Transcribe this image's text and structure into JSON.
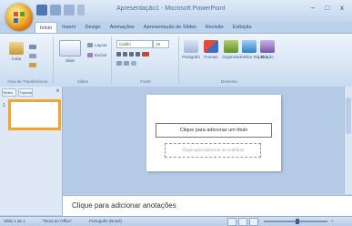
{
  "window": {
    "title": "Apresentação1 - Microsoft PowerPoint",
    "minimize": "–",
    "maximize": "□",
    "close": "x"
  },
  "tabs": [
    "Início",
    "Inserir",
    "Design",
    "Animações",
    "Apresentação de Slides",
    "Revisão",
    "Exibição"
  ],
  "ribbon": {
    "paste_label": "Colar",
    "new_slide_label": "Slide",
    "delete_label": "Excluir",
    "font_name": "Calibri",
    "font_size": "18",
    "drawing_label": "Desenho",
    "edit_label": "Edição",
    "layout_label": "Layout",
    "shapes_label": "Formas",
    "arrange_label": "Organizar",
    "quick_styles_label": "Estilos Rápidos",
    "groups": {
      "clipboard": "Área de Transferência",
      "slides": "Slides",
      "font": "Fonte",
      "paragraph": "Parágrafo",
      "drawing": "Desenho"
    }
  },
  "slide_pane": {
    "tab_slides": "Slides",
    "tab_outline": "Tópicos",
    "close": "x",
    "slide_number": "1"
  },
  "slide": {
    "title_placeholder": "Clique para adicionar um título",
    "subtitle_placeholder": "Clique para adicionar um subtítulo"
  },
  "notes": {
    "placeholder": "Clique para adicionar anotações"
  },
  "status": {
    "slide_info": "Slide 1 de 1",
    "theme": "\"Tema do Office\"",
    "language": "Português (Brasil)",
    "zoom_out": "–",
    "zoom_in": "+"
  }
}
